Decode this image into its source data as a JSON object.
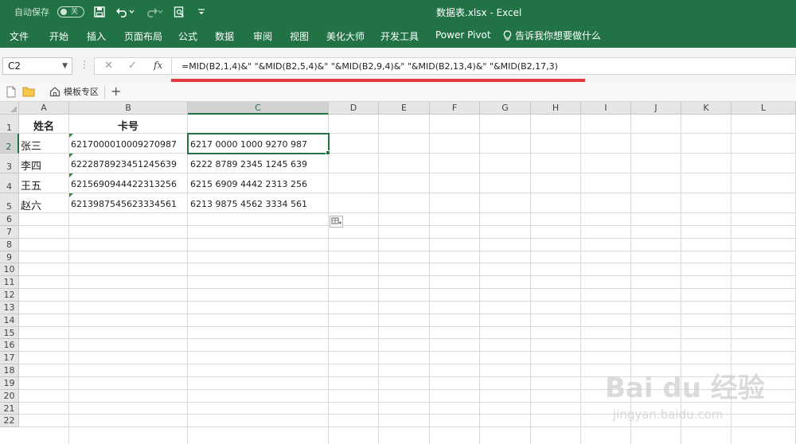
{
  "titlebar": {
    "autosave_label": "自动保存",
    "autosave_state": "关",
    "title": "数据表.xlsx  -  Excel"
  },
  "ribbon": {
    "tabs": [
      "文件",
      "开始",
      "插入",
      "页面布局",
      "公式",
      "数据",
      "审阅",
      "视图",
      "美化大师",
      "开发工具",
      "Power Pivot"
    ],
    "tell_me": "告诉我你想要做什么"
  },
  "formula_bar": {
    "name_box": "C2",
    "formula": "=MID(B2,1,4)&\" \"&MID(B2,5,4)&\" \"&MID(B2,9,4)&\" \"&MID(B2,13,4)&\" \"&MID(B2,17,3)",
    "fx_label": "fx"
  },
  "sheet_bar": {
    "templates_label": "模板专区"
  },
  "columns": [
    "A",
    "B",
    "C",
    "D",
    "E",
    "F",
    "G",
    "H",
    "I",
    "J",
    "K",
    "L"
  ],
  "rows": [
    "1",
    "2",
    "3",
    "4",
    "5",
    "6",
    "7",
    "8",
    "9",
    "10",
    "11",
    "12",
    "13",
    "14",
    "15",
    "16",
    "17",
    "18",
    "19",
    "20",
    "21",
    "22"
  ],
  "table": {
    "headers": {
      "A": "姓名",
      "B": "卡号"
    },
    "data": [
      {
        "name": "张三",
        "card": "6217000010009270987",
        "formatted": "6217 0000 1000 9270 987"
      },
      {
        "name": "李四",
        "card": "6222878923451245639",
        "formatted": "6222 8789 2345 1245 639"
      },
      {
        "name": "王五",
        "card": "6215690944422313256",
        "formatted": "6215 6909 4442 2313 256"
      },
      {
        "name": "赵六",
        "card": "6213987545623334561",
        "formatted": "6213 9875 4562 3334 561"
      }
    ]
  },
  "watermark": {
    "brand": "Bai du 经验",
    "url": "jingyan.baidu.com"
  },
  "colors": {
    "excel_green": "#217346",
    "highlight_red": "#e0393e"
  }
}
